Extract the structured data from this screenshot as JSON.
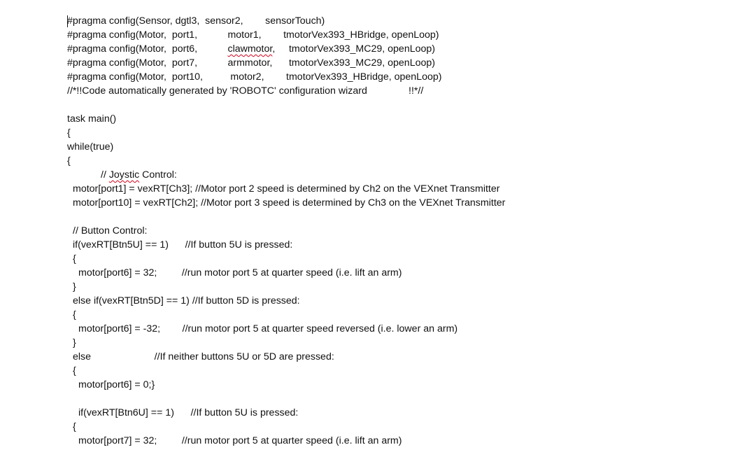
{
  "lines": [
    {
      "row": 0,
      "segments": [
        {
          "text": "#pragma config(Sensor, dgtl3,  sensor2,        sensorTouch)"
        }
      ]
    },
    {
      "row": 1,
      "segments": [
        {
          "text": "#pragma config(Motor,  port1,           motor1,        tmotorVex393_HBridge, openLoop)"
        }
      ]
    },
    {
      "row": 2,
      "segments": [
        {
          "text": "#pragma config(Motor,  port6,           "
        },
        {
          "text": "clawmotor",
          "spell": true
        },
        {
          "text": ",     tmotorVex393_MC29, openLoop)"
        }
      ]
    },
    {
      "row": 3,
      "segments": [
        {
          "text": "#pragma config(Motor,  port7,           armmotor,      tmotorVex393_MC29, openLoop)"
        }
      ]
    },
    {
      "row": 4,
      "segments": [
        {
          "text": "#pragma config(Motor,  port10,          motor2,        tmotorVex393_HBridge, openLoop)"
        }
      ]
    },
    {
      "row": 5,
      "segments": [
        {
          "text": "//*!!Code automatically generated by 'ROBOTC' configuration wizard               !!*//"
        }
      ]
    },
    {
      "row": 7,
      "segments": [
        {
          "text": "task main()"
        }
      ]
    },
    {
      "row": 8,
      "segments": [
        {
          "text": "{"
        }
      ]
    },
    {
      "row": 9,
      "segments": [
        {
          "text": "while(true)"
        }
      ]
    },
    {
      "row": 10,
      "segments": [
        {
          "text": "{"
        }
      ]
    },
    {
      "row": 11,
      "indent": 48,
      "segments": [
        {
          "text": "// "
        },
        {
          "text": "Joystic",
          "spell": true
        },
        {
          "text": " Control:"
        }
      ]
    },
    {
      "row": 12,
      "indent": 8,
      "segments": [
        {
          "text": "motor[port1] = vexRT[Ch3]; //Motor port 2 speed is determined by Ch2 on the VEXnet Transmitter"
        }
      ]
    },
    {
      "row": 13,
      "indent": 8,
      "segments": [
        {
          "text": "motor[port10] = vexRT[Ch2]; //Motor port 3 speed is determined by Ch3 on the VEXnet Transmitter"
        }
      ]
    },
    {
      "row": 15,
      "indent": 8,
      "segments": [
        {
          "text": "// Button Control:"
        }
      ]
    },
    {
      "row": 16,
      "indent": 8,
      "segments": [
        {
          "text": "if(vexRT[Btn5U] == 1)      //If button 5U is pressed:"
        }
      ]
    },
    {
      "row": 17,
      "indent": 8,
      "segments": [
        {
          "text": "{"
        }
      ]
    },
    {
      "row": 18,
      "indent": 16,
      "segments": [
        {
          "text": "motor[port6] = 32;         //run motor port 5 at quarter speed (i.e. lift an arm)"
        }
      ]
    },
    {
      "row": 19,
      "indent": 8,
      "segments": [
        {
          "text": "}"
        }
      ]
    },
    {
      "row": 20,
      "indent": 8,
      "segments": [
        {
          "text": "else if(vexRT[Btn5D] == 1) //If button 5D is pressed:"
        }
      ]
    },
    {
      "row": 21,
      "indent": 8,
      "segments": [
        {
          "text": "{"
        }
      ]
    },
    {
      "row": 22,
      "indent": 16,
      "segments": [
        {
          "text": "motor[port6] = -32;        //run motor port 5 at quarter speed reversed (i.e. lower an arm)"
        }
      ]
    },
    {
      "row": 23,
      "indent": 8,
      "segments": [
        {
          "text": "}"
        }
      ]
    },
    {
      "row": 24,
      "indent": 8,
      "segments": [
        {
          "text": "else                       //If neither buttons 5U or 5D are pressed:"
        }
      ]
    },
    {
      "row": 25,
      "indent": 8,
      "segments": [
        {
          "text": "{"
        }
      ]
    },
    {
      "row": 26,
      "indent": 16,
      "segments": [
        {
          "text": "motor[port6] = 0;}"
        }
      ]
    },
    {
      "row": 28,
      "indent": 16,
      "segments": [
        {
          "text": "if(vexRT[Btn6U] == 1)      //If button 5U is pressed:"
        }
      ]
    },
    {
      "row": 29,
      "indent": 8,
      "segments": [
        {
          "text": "{"
        }
      ]
    },
    {
      "row": 30,
      "indent": 16,
      "segments": [
        {
          "text": "motor[port7] = 32;         //run motor port 5 at quarter speed (i.e. lift an arm)"
        }
      ]
    }
  ]
}
